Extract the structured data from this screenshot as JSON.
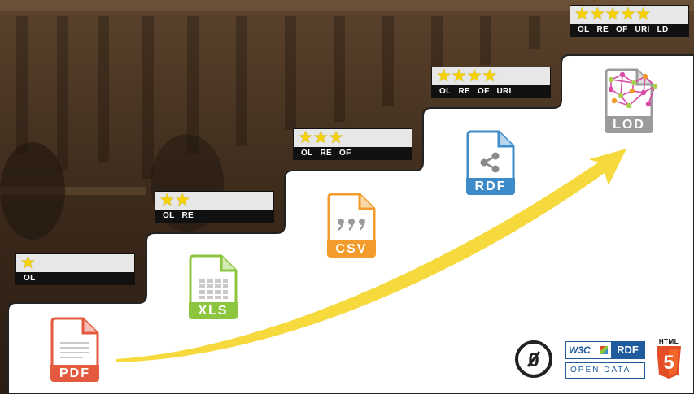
{
  "steps": [
    {
      "stars": "★",
      "labels": [
        "OL"
      ]
    },
    {
      "stars": "★★",
      "labels": [
        "OL",
        "RE"
      ]
    },
    {
      "stars": "★★★",
      "labels": [
        "OL",
        "RE",
        "OF"
      ]
    },
    {
      "stars": "★★★★",
      "labels": [
        "OL",
        "RE",
        "OF",
        "URI"
      ]
    },
    {
      "stars": "★★★★★",
      "labels": [
        "OL",
        "RE",
        "OF",
        "URI",
        "LD"
      ]
    }
  ],
  "formats": {
    "pdf": "PDF",
    "xls": "XLS",
    "csv": "CSV",
    "rdf": "RDF",
    "lod": "LOD"
  },
  "logos": {
    "cc_zero": "0",
    "w3c": "W3C",
    "rdf": "RDF",
    "open_data": "OPEN DATA",
    "html5_label": "HTML",
    "html5_number": "5"
  },
  "colors": {
    "pdf": "#e35a3f",
    "xls": "#8cc63e",
    "csv": "#f39c2b",
    "rdf": "#3d8bc9",
    "lod": "#9b9b9b",
    "star": "#f5d200",
    "arrow": "#f6d93c",
    "html5": "#e44d26",
    "w3c_blue": "#1e5a9c"
  }
}
